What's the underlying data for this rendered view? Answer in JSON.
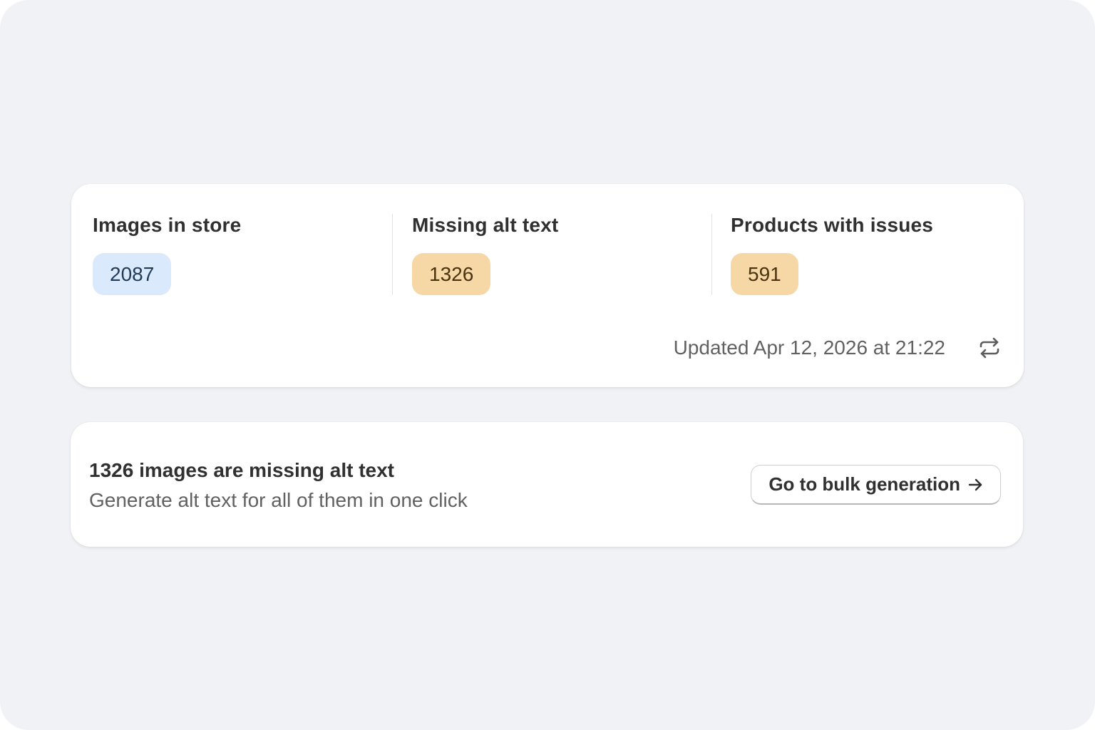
{
  "stats": {
    "items": [
      {
        "label": "Images in store",
        "value": "2087",
        "badge_color": "#dbe9fc"
      },
      {
        "label": "Missing alt text",
        "value": "1326",
        "badge_color": "#f6d7a6"
      },
      {
        "label": "Products with issues",
        "value": "591",
        "badge_color": "#f6d7a6"
      }
    ],
    "updated_text": "Updated Apr 12, 2026 at 21:22",
    "refresh_icon": "refresh-icon"
  },
  "cta": {
    "title": "1326 images are missing alt text",
    "subtitle": "Generate alt text for all of them in one click",
    "button_label": "Go to bulk generation",
    "button_icon": "arrow-right-icon"
  },
  "colors": {
    "background": "#f1f2f6",
    "card": "#ffffff",
    "info_badge": "#dbe9fc",
    "warning_badge": "#f6d7a6",
    "text_primary": "#303030",
    "text_secondary": "#616161"
  }
}
